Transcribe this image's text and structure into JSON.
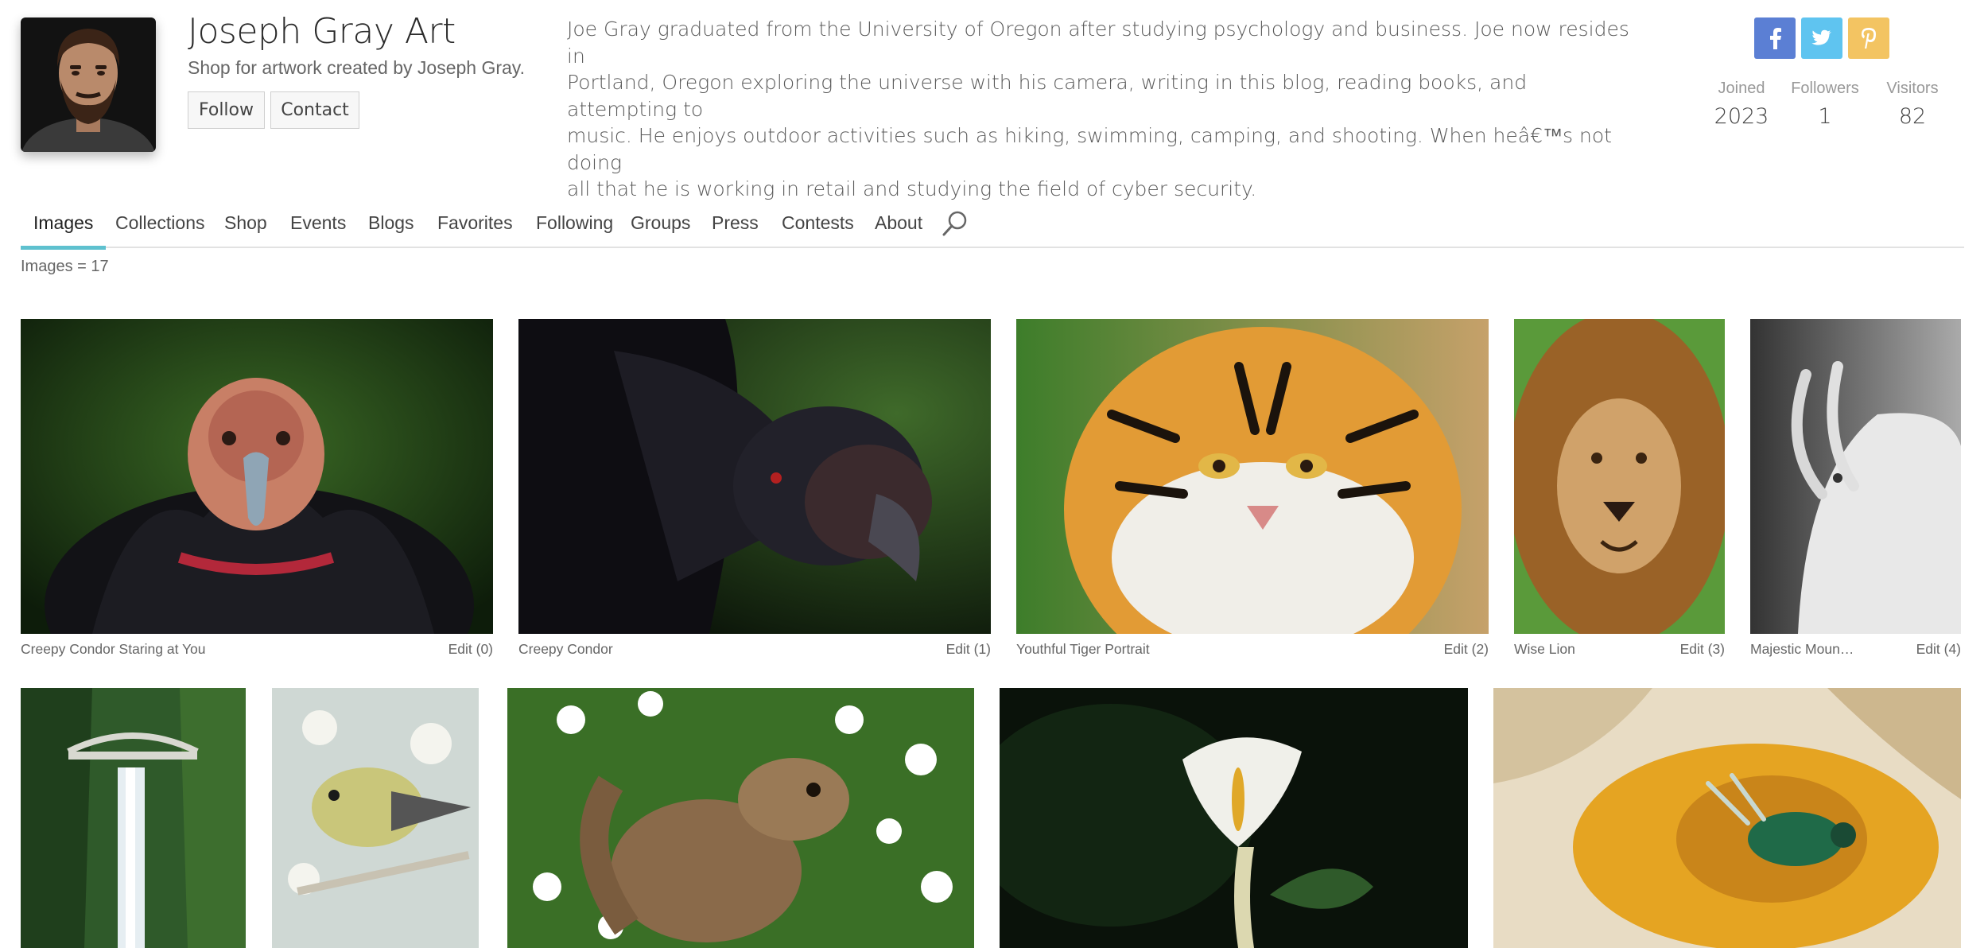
{
  "profile": {
    "title": "Joseph Gray Art",
    "subtitle": "Shop for artwork created by Joseph Gray.",
    "follow_label": "Follow",
    "contact_label": "Contact",
    "bio": "Joe Gray graduated from the University of Oregon after studying psychology and business.   Joe now resides in\nPortland, Oregon exploring the universe with his camera, writing in this blog, reading books, and attempting to\nmusic.   He enjoys outdoor activities such as hiking, swimming, camping, and shooting.   When heâ€™s not doing\nall that he is working in retail and studying the field of cyber security."
  },
  "social": [
    {
      "name": "facebook-icon",
      "color": "#5b7fd4"
    },
    {
      "name": "twitter-icon",
      "color": "#5fc4f0"
    },
    {
      "name": "pinterest-icon",
      "color": "#f3c462"
    }
  ],
  "stats": {
    "joined_label": "Joined",
    "joined_value": "2023",
    "followers_label": "Followers",
    "followers_value": "1",
    "visitors_label": "Visitors",
    "visitors_value": "82"
  },
  "tabs": [
    "Images",
    "Collections",
    "Shop",
    "Events",
    "Blogs",
    "Favorites",
    "Following",
    "Groups",
    "Press",
    "Contests",
    "About"
  ],
  "active_tab": "Images",
  "image_count": "Images = 17",
  "gallery": [
    {
      "caption": "Creepy Condor Staring at You",
      "edit": "Edit (0)"
    },
    {
      "caption": "Creepy Condor",
      "edit": "Edit (1)"
    },
    {
      "caption": "Youthful Tiger Portrait",
      "edit": "Edit (2)"
    },
    {
      "caption": "Wise Lion",
      "edit": "Edit (3)"
    },
    {
      "caption": "Majestic Moun…",
      "edit": "Edit (4)"
    }
  ],
  "accent_color": "#5ec1cf"
}
